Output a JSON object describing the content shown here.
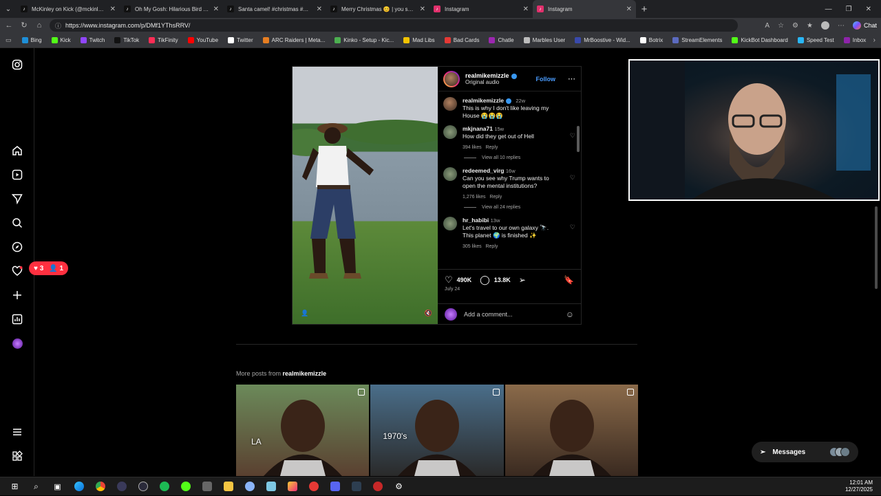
{
  "browser": {
    "tabs": [
      {
        "title": "McKinley on Kick (@mckinley.tv) |",
        "icon": "tiktok-icon",
        "color": "#111111"
      },
      {
        "title": "Oh My Gosh: Hilarious Bird and Sp",
        "icon": "tiktok-icon",
        "color": "#111111"
      },
      {
        "title": "Santa camel! #christmas #merrych",
        "icon": "tiktok-icon",
        "color": "#111111"
      },
      {
        "title": "Merry Christmas 😊 | you see how",
        "icon": "tiktok-icon",
        "color": "#111111"
      },
      {
        "title": "Instagram",
        "icon": "instagram-icon",
        "color": "#e1306c"
      },
      {
        "title": "Instagram",
        "icon": "instagram-icon",
        "color": "#e1306c"
      }
    ],
    "url": "https://www.instagram.com/p/DMf1YThsRRV/",
    "chat_label": "Chat",
    "bookmarks": [
      {
        "label": "Bing",
        "color": "#1e8fd8"
      },
      {
        "label": "Kick",
        "color": "#53fc18"
      },
      {
        "label": "Twitch",
        "color": "#9146ff"
      },
      {
        "label": "TikTok",
        "color": "#111111"
      },
      {
        "label": "TikFinity",
        "color": "#ff2d55"
      },
      {
        "label": "YouTube",
        "color": "#ff0000"
      },
      {
        "label": "Twitter",
        "color": "#ffffff"
      },
      {
        "label": "ARC Raiders | Meta...",
        "color": "#e67e22"
      },
      {
        "label": "Kinko - Setup - Kic...",
        "color": "#4caf50"
      },
      {
        "label": "Mad Libs",
        "color": "#f2c300"
      },
      {
        "label": "Bad Cards",
        "color": "#e53935"
      },
      {
        "label": "Chatle",
        "color": "#9c27b0"
      },
      {
        "label": "Marbles User",
        "color": "#bdbdbd"
      },
      {
        "label": "MrBoostive - Wid...",
        "color": "#3949ab"
      },
      {
        "label": "Botrix",
        "color": "#ffffff"
      },
      {
        "label": "StreamElements",
        "color": "#5c6bc0"
      },
      {
        "label": "KickBot Dashboard",
        "color": "#53fc18"
      },
      {
        "label": "Speed Test",
        "color": "#29b6f6"
      },
      {
        "label": "Inbox",
        "color": "#8e24aa"
      }
    ]
  },
  "sidebar": {
    "notifications": {
      "likes": "3",
      "follows": "1"
    }
  },
  "post": {
    "author": "realmikemizzle",
    "audio": "Original audio",
    "follow_label": "Follow",
    "caption": {
      "user": "realmikemizzle",
      "time": "22w",
      "text": "This is why I don't like leaving my House 😭😭😭"
    },
    "comments": [
      {
        "user": "mkjnana71",
        "time": "15w",
        "text": "How did they get out of Hell",
        "likes": "394 likes",
        "reply": "Reply",
        "view_all": "View all 10 replies"
      },
      {
        "user": "redeemed_virg",
        "time": "16w",
        "text": "Can you see why Trump wants to open the mental institutions?",
        "likes": "1,276 likes",
        "reply": "Reply",
        "view_all": "View all 24 replies"
      },
      {
        "user": "hr_habibi",
        "time": "13w",
        "text": "Let's travel to our own galaxy 🔭. This planet 🌍 is finished ✨",
        "likes": "305 likes",
        "reply": "Reply",
        "view_all": ""
      }
    ],
    "like_count": "490K",
    "comment_count": "13.8K",
    "date": "July 24",
    "add_comment_placeholder": "Add a comment..."
  },
  "more_posts": {
    "prefix": "More posts from",
    "user": "realmikemizzle",
    "items": [
      {
        "overlay": "LA",
        "colors": [
          "#6b8a5a",
          "#5a4030"
        ]
      },
      {
        "overlay": "1970's",
        "colors": [
          "#4a6e8a",
          "#2a2a2a"
        ]
      },
      {
        "overlay": "",
        "colors": [
          "#8a6a4a",
          "#3a2a20"
        ]
      }
    ]
  },
  "messages_label": "Messages",
  "clock": {
    "time": "12:01 AM",
    "date": "12/27/2025"
  }
}
